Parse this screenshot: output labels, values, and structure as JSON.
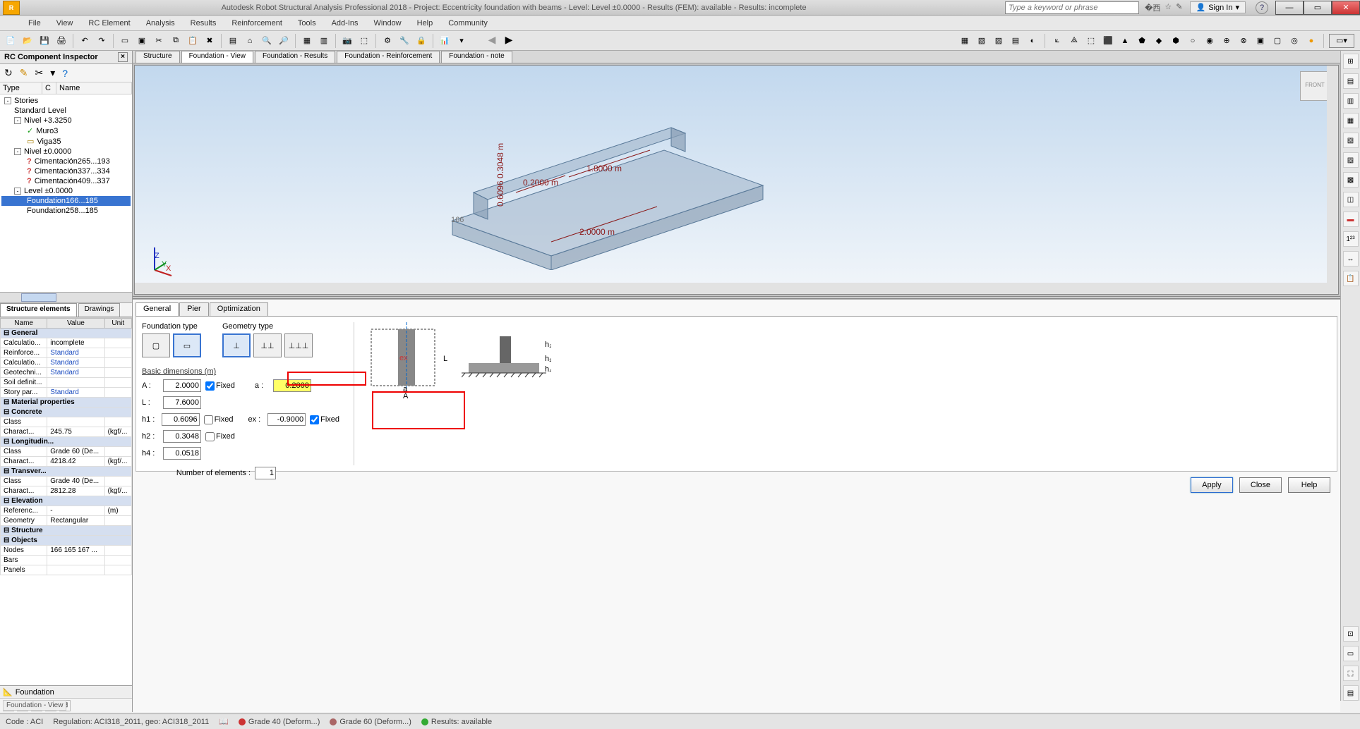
{
  "titlebar": {
    "title": "Autodesk Robot Structural Analysis Professional 2018 - Project: Eccentricity foundation with beams - Level: Level ±0.0000 - Results (FEM): available - Results: incomplete",
    "search_placeholder": "Type a keyword or phrase",
    "signin": "Sign In"
  },
  "menu": [
    "File",
    "View",
    "RC Element",
    "Analysis",
    "Results",
    "Reinforcement",
    "Tools",
    "Add-Ins",
    "Window",
    "Help",
    "Community"
  ],
  "left_panel": {
    "title": "RC Component Inspector",
    "tree_cols": [
      "Type",
      "C",
      "Name"
    ],
    "tree": [
      {
        "lvl": 1,
        "box": "-",
        "ico": "",
        "label": "Stories",
        "sel": false
      },
      {
        "lvl": 2,
        "box": "",
        "ico": "",
        "label": "Standard Level",
        "sel": false
      },
      {
        "lvl": 2,
        "box": "-",
        "ico": "",
        "label": "Nivel +3.3250",
        "sel": false
      },
      {
        "lvl": 3,
        "box": "",
        "ico": "✓",
        "icoClass": "ico-ok",
        "label": "Muro3",
        "sel": false
      },
      {
        "lvl": 3,
        "box": "",
        "ico": "▭",
        "icoClass": "ico-f",
        "label": "Viga35",
        "sel": false
      },
      {
        "lvl": 2,
        "box": "-",
        "ico": "",
        "label": "Nivel ±0.0000",
        "sel": false
      },
      {
        "lvl": 3,
        "box": "",
        "ico": "?",
        "icoClass": "ico-q",
        "label": "Cimentación265...193",
        "sel": false
      },
      {
        "lvl": 3,
        "box": "",
        "ico": "?",
        "icoClass": "ico-q",
        "label": "Cimentación337...334",
        "sel": false
      },
      {
        "lvl": 3,
        "box": "",
        "ico": "?",
        "icoClass": "ico-q",
        "label": "Cimentación409...337",
        "sel": false
      },
      {
        "lvl": 2,
        "box": "-",
        "ico": "",
        "label": "Level ±0.0000",
        "sel": false
      },
      {
        "lvl": 3,
        "box": "",
        "ico": "",
        "label": "Foundation166...185",
        "sel": true
      },
      {
        "lvl": 3,
        "box": "",
        "ico": "",
        "label": "Foundation258...185",
        "sel": false
      }
    ],
    "se_tabs": [
      "Structure elements",
      "Drawings"
    ],
    "se_active": 0,
    "prop_cols": [
      "Name",
      "Value",
      "Unit"
    ],
    "prop_groups": [
      {
        "group": "General",
        "rows": [
          {
            "n": "Calculatio...",
            "v": "incomplete",
            "u": ""
          },
          {
            "n": "Reinforce...",
            "v": "Standard",
            "u": "",
            "link": true
          },
          {
            "n": "Calculatio...",
            "v": "Standard",
            "u": "",
            "link": true
          },
          {
            "n": "Geotechni...",
            "v": "Standard",
            "u": "",
            "link": true
          },
          {
            "n": "Soil definit...",
            "v": "",
            "u": ""
          },
          {
            "n": "Story par...",
            "v": "Standard",
            "u": "",
            "link": true
          }
        ]
      },
      {
        "group": "Material properties",
        "rows": []
      },
      {
        "group": "Concrete",
        "rows": [
          {
            "n": "Class",
            "v": "",
            "u": ""
          },
          {
            "n": "Charact...",
            "v": "245.75",
            "u": "(kgf/..."
          }
        ]
      },
      {
        "group": "Longitudin...",
        "rows": [
          {
            "n": "Class",
            "v": "Grade 60 (De...",
            "u": ""
          },
          {
            "n": "Charact...",
            "v": "4218.42",
            "u": "(kgf/..."
          }
        ]
      },
      {
        "group": "Transver...",
        "rows": [
          {
            "n": "Class",
            "v": "Grade 40 (De...",
            "u": ""
          },
          {
            "n": "Charact...",
            "v": "2812.28",
            "u": "(kgf/..."
          }
        ]
      },
      {
        "group": "Elevation",
        "rows": [
          {
            "n": "Referenc...",
            "v": "-",
            "u": "(m)"
          },
          {
            "n": "Geometry",
            "v": "Rectangular",
            "u": ""
          }
        ]
      },
      {
        "group": "Structure",
        "rows": []
      },
      {
        "group": "Objects",
        "rows": [
          {
            "n": "Nodes",
            "v": "166 165 167 ...",
            "u": ""
          },
          {
            "n": "Bars",
            "v": "",
            "u": ""
          },
          {
            "n": "Panels",
            "v": "",
            "u": ""
          }
        ]
      }
    ],
    "foundation_tab": "Foundation"
  },
  "doc_tabs": [
    "Structure",
    "Foundation - View",
    "Foundation - Results",
    "Foundation - Reinforcement",
    "Foundation - note"
  ],
  "doc_tab_active": 1,
  "viewport": {
    "node_label": "166",
    "dims": {
      "d1": "0.2000 m",
      "d2": "1.8000 m",
      "d3": "2.0000 m",
      "vh": "0.6096",
      "vh2": "0.3048 m"
    }
  },
  "sub_tabs": [
    "General",
    "Pier",
    "Optimization"
  ],
  "sub_tab_active": 0,
  "form": {
    "foundation_type_label": "Foundation type",
    "geometry_type_label": "Geometry type",
    "basic_dim_label": "Basic dimensions (m)",
    "A": {
      "label": "A :",
      "val": "2.0000",
      "fixed": true
    },
    "a": {
      "label": "a :",
      "val": "0.2000"
    },
    "L": {
      "label": "L :",
      "val": "7.6000"
    },
    "h1": {
      "label": "h1 :",
      "val": "0.6096",
      "fixed": false
    },
    "ex": {
      "label": "ex :",
      "val": "-0.9000",
      "fixed": true
    },
    "h2": {
      "label": "h2 :",
      "val": "0.3048",
      "fixed": false
    },
    "h4": {
      "label": "h4 :",
      "val": "0.0518"
    },
    "num_label": "Number of elements :",
    "num_val": "1",
    "fixed_label": "Fixed"
  },
  "buttons": {
    "apply": "Apply",
    "close": "Close",
    "help": "Help"
  },
  "status": {
    "fv": "Foundation - View",
    "code": "Code : ACI",
    "reg": "Regulation: ACI318_2011, geo: ACI318_2011",
    "g40": "Grade 40 (Deform...)",
    "g60": "Grade 60 (Deform...)",
    "res": "Results: available"
  }
}
